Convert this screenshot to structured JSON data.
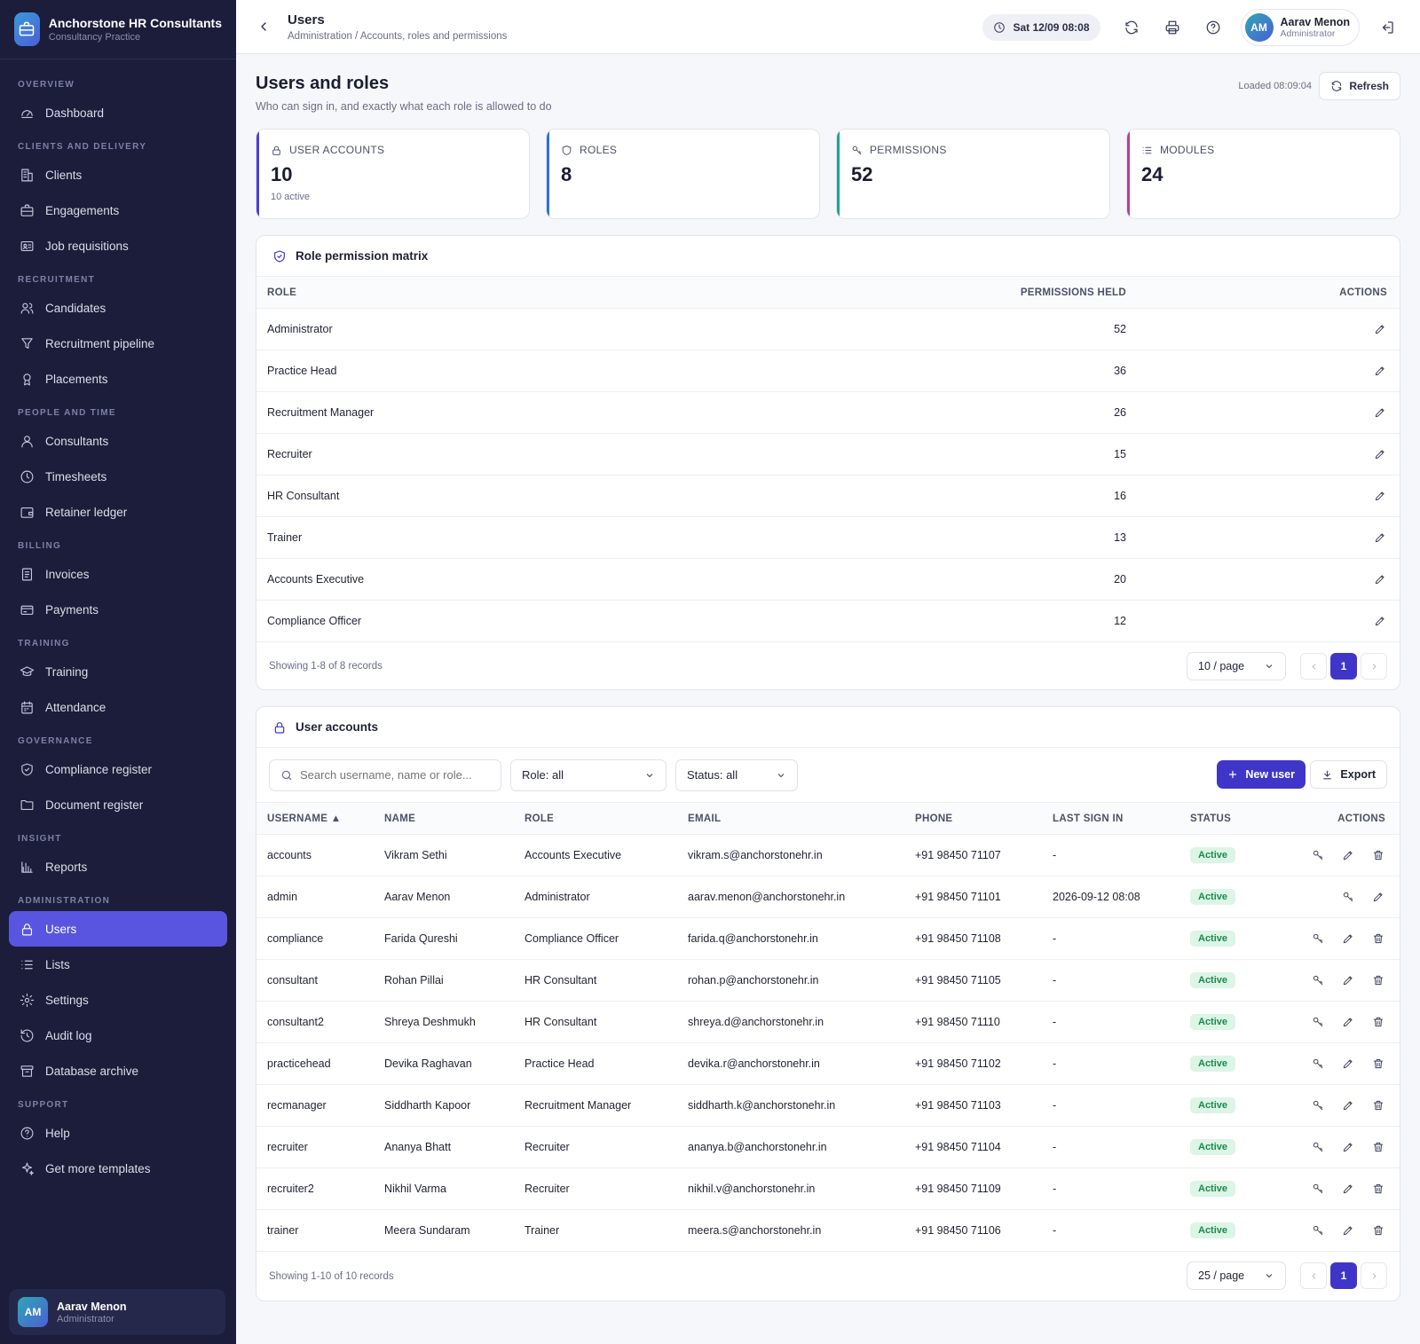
{
  "brand": {
    "name": "Anchorstone HR Consultants",
    "sub": "Consultancy Practice"
  },
  "nav": [
    {
      "section": "OVERVIEW",
      "items": [
        {
          "label": "Dashboard",
          "icon": "gauge-icon"
        }
      ]
    },
    {
      "section": "CLIENTS AND DELIVERY",
      "items": [
        {
          "label": "Clients",
          "icon": "building-icon"
        },
        {
          "label": "Engagements",
          "icon": "briefcase-icon"
        },
        {
          "label": "Job requisitions",
          "icon": "id-card-icon"
        }
      ]
    },
    {
      "section": "RECRUITMENT",
      "items": [
        {
          "label": "Candidates",
          "icon": "users-icon"
        },
        {
          "label": "Recruitment pipeline",
          "icon": "filter-icon"
        },
        {
          "label": "Placements",
          "icon": "badge-icon"
        }
      ]
    },
    {
      "section": "PEOPLE AND TIME",
      "items": [
        {
          "label": "Consultants",
          "icon": "user-icon"
        },
        {
          "label": "Timesheets",
          "icon": "clock-icon"
        },
        {
          "label": "Retainer ledger",
          "icon": "wallet-icon"
        }
      ]
    },
    {
      "section": "BILLING",
      "items": [
        {
          "label": "Invoices",
          "icon": "invoice-icon"
        },
        {
          "label": "Payments",
          "icon": "card-icon"
        }
      ]
    },
    {
      "section": "TRAINING",
      "items": [
        {
          "label": "Training",
          "icon": "graduation-icon"
        },
        {
          "label": "Attendance",
          "icon": "calendar-icon"
        }
      ]
    },
    {
      "section": "GOVERNANCE",
      "items": [
        {
          "label": "Compliance register",
          "icon": "shield-check-icon"
        },
        {
          "label": "Document register",
          "icon": "folder-icon"
        }
      ]
    },
    {
      "section": "INSIGHT",
      "items": [
        {
          "label": "Reports",
          "icon": "bar-chart-icon"
        }
      ]
    },
    {
      "section": "ADMINISTRATION",
      "items": [
        {
          "label": "Users",
          "icon": "lock-icon",
          "active": true
        },
        {
          "label": "Lists",
          "icon": "list-icon"
        },
        {
          "label": "Settings",
          "icon": "gear-icon"
        },
        {
          "label": "Audit log",
          "icon": "history-icon"
        },
        {
          "label": "Database archive",
          "icon": "archive-icon"
        }
      ]
    },
    {
      "section": "SUPPORT",
      "items": [
        {
          "label": "Help",
          "icon": "help-icon"
        },
        {
          "label": "Get more templates",
          "icon": "sparkle-icon"
        }
      ]
    }
  ],
  "user": {
    "initials": "AM",
    "name": "Aarav Menon",
    "role": "Administrator"
  },
  "topbar": {
    "title": "Users",
    "breadcrumb": "Administration / Accounts, roles and permissions",
    "datetime": "Sat 12/09 08:08"
  },
  "page": {
    "title": "Users and roles",
    "subtitle": "Who can sign in, and exactly what each role is allowed to do",
    "loaded": "Loaded 08:09:04",
    "refresh": "Refresh"
  },
  "stats": [
    {
      "label": "USER ACCOUNTS",
      "value": "10",
      "note": "10 active",
      "color": "#4a3fd0",
      "icon": "lock-icon"
    },
    {
      "label": "ROLES",
      "value": "8",
      "note": "",
      "color": "#2f6fd6",
      "icon": "shield-icon"
    },
    {
      "label": "PERMISSIONS",
      "value": "52",
      "note": "",
      "color": "#1fa38f",
      "icon": "key-icon"
    },
    {
      "label": "MODULES",
      "value": "24",
      "note": "",
      "color": "#b0458e",
      "icon": "list-icon"
    }
  ],
  "matrix": {
    "title": "Role permission matrix",
    "columns": [
      "ROLE",
      "PERMISSIONS HELD",
      "ACTIONS"
    ],
    "rows": [
      {
        "role": "Administrator",
        "count": "52"
      },
      {
        "role": "Practice Head",
        "count": "36"
      },
      {
        "role": "Recruitment Manager",
        "count": "26"
      },
      {
        "role": "Recruiter",
        "count": "15"
      },
      {
        "role": "HR Consultant",
        "count": "16"
      },
      {
        "role": "Trainer",
        "count": "13"
      },
      {
        "role": "Accounts Executive",
        "count": "20"
      },
      {
        "role": "Compliance Officer",
        "count": "12"
      }
    ],
    "footer": "Showing 1-8 of 8 records",
    "pagesize": "10 / page",
    "page": "1"
  },
  "accounts": {
    "title": "User accounts",
    "search_placeholder": "Search username, name or role...",
    "role_filter": "Role: all",
    "status_filter": "Status: all",
    "new_user": "New user",
    "export": "Export",
    "columns": [
      "USERNAME ▲",
      "NAME",
      "ROLE",
      "EMAIL",
      "PHONE",
      "LAST SIGN IN",
      "STATUS",
      "ACTIONS"
    ],
    "rows": [
      {
        "username": "accounts",
        "name": "Vikram Sethi",
        "role": "Accounts Executive",
        "email": "vikram.s@anchorstonehr.in",
        "phone": "+91 98450 71107",
        "last": "-",
        "status": "Active",
        "deletable": true
      },
      {
        "username": "admin",
        "name": "Aarav Menon",
        "role": "Administrator",
        "email": "aarav.menon@anchorstonehr.in",
        "phone": "+91 98450 71101",
        "last": "2026-09-12 08:08",
        "status": "Active",
        "deletable": false
      },
      {
        "username": "compliance",
        "name": "Farida Qureshi",
        "role": "Compliance Officer",
        "email": "farida.q@anchorstonehr.in",
        "phone": "+91 98450 71108",
        "last": "-",
        "status": "Active",
        "deletable": true
      },
      {
        "username": "consultant",
        "name": "Rohan Pillai",
        "role": "HR Consultant",
        "email": "rohan.p@anchorstonehr.in",
        "phone": "+91 98450 71105",
        "last": "-",
        "status": "Active",
        "deletable": true
      },
      {
        "username": "consultant2",
        "name": "Shreya Deshmukh",
        "role": "HR Consultant",
        "email": "shreya.d@anchorstonehr.in",
        "phone": "+91 98450 71110",
        "last": "-",
        "status": "Active",
        "deletable": true
      },
      {
        "username": "practicehead",
        "name": "Devika Raghavan",
        "role": "Practice Head",
        "email": "devika.r@anchorstonehr.in",
        "phone": "+91 98450 71102",
        "last": "-",
        "status": "Active",
        "deletable": true
      },
      {
        "username": "recmanager",
        "name": "Siddharth Kapoor",
        "role": "Recruitment Manager",
        "email": "siddharth.k@anchorstonehr.in",
        "phone": "+91 98450 71103",
        "last": "-",
        "status": "Active",
        "deletable": true
      },
      {
        "username": "recruiter",
        "name": "Ananya Bhatt",
        "role": "Recruiter",
        "email": "ananya.b@anchorstonehr.in",
        "phone": "+91 98450 71104",
        "last": "-",
        "status": "Active",
        "deletable": true
      },
      {
        "username": "recruiter2",
        "name": "Nikhil Varma",
        "role": "Recruiter",
        "email": "nikhil.v@anchorstonehr.in",
        "phone": "+91 98450 71109",
        "last": "-",
        "status": "Active",
        "deletable": true
      },
      {
        "username": "trainer",
        "name": "Meera Sundaram",
        "role": "Trainer",
        "email": "meera.s@anchorstonehr.in",
        "phone": "+91 98450 71106",
        "last": "-",
        "status": "Active",
        "deletable": true
      }
    ],
    "footer": "Showing 1-10 of 10 records",
    "pagesize": "25 / page",
    "page": "1"
  }
}
